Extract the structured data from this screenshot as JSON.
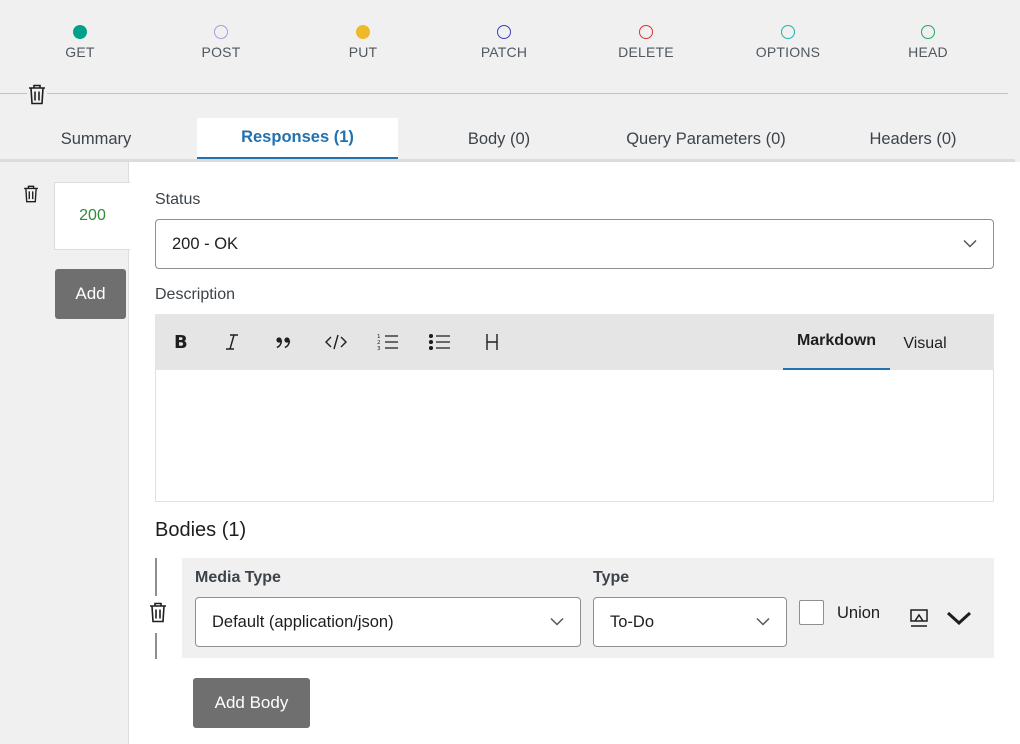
{
  "methods": [
    {
      "label": "GET",
      "color": "#00a08a",
      "filled": true,
      "selected": false
    },
    {
      "label": "POST",
      "color": "#b197d9",
      "filled": false,
      "selected": false
    },
    {
      "label": "PUT",
      "color": "#f0b92b",
      "filled": true,
      "selected": true
    },
    {
      "label": "PATCH",
      "color": "#3b3fb5",
      "filled": false,
      "selected": false
    },
    {
      "label": "DELETE",
      "color": "#d63638",
      "filled": false,
      "selected": false
    },
    {
      "label": "OPTIONS",
      "color": "#1fb3b3",
      "filled": false,
      "selected": false
    },
    {
      "label": "HEAD",
      "color": "#1ea85a",
      "filled": false,
      "selected": false
    }
  ],
  "tabs": [
    {
      "label": "Summary",
      "active": false
    },
    {
      "label": "Responses (1)",
      "active": true
    },
    {
      "label": "Body (0)",
      "active": false
    },
    {
      "label": "Query Parameters (0)",
      "active": false
    },
    {
      "label": "Headers (0)",
      "active": false
    }
  ],
  "responses": {
    "codes": [
      "200"
    ],
    "add_label": "Add"
  },
  "response": {
    "status_label": "Status",
    "status_value": "200 - OK",
    "description_label": "Description",
    "editor": {
      "toolbar": [
        "bold-icon",
        "italic-icon",
        "quote-icon",
        "code-icon",
        "ordered-list-icon",
        "unordered-list-icon",
        "heading-icon"
      ],
      "modes": [
        {
          "label": "Markdown",
          "active": true
        },
        {
          "label": "Visual",
          "active": false
        }
      ]
    },
    "bodies_title": "Bodies (1)",
    "body": {
      "media_type_label": "Media Type",
      "media_type_value": "Default (application/json)",
      "type_label": "Type",
      "type_value": "To-Do",
      "union_label": "Union",
      "union_checked": false
    },
    "add_body_label": "Add Body"
  },
  "colors": {
    "accent": "#2271b1",
    "status_code": "#2e8a36",
    "button_bg": "#6f6f6f"
  }
}
